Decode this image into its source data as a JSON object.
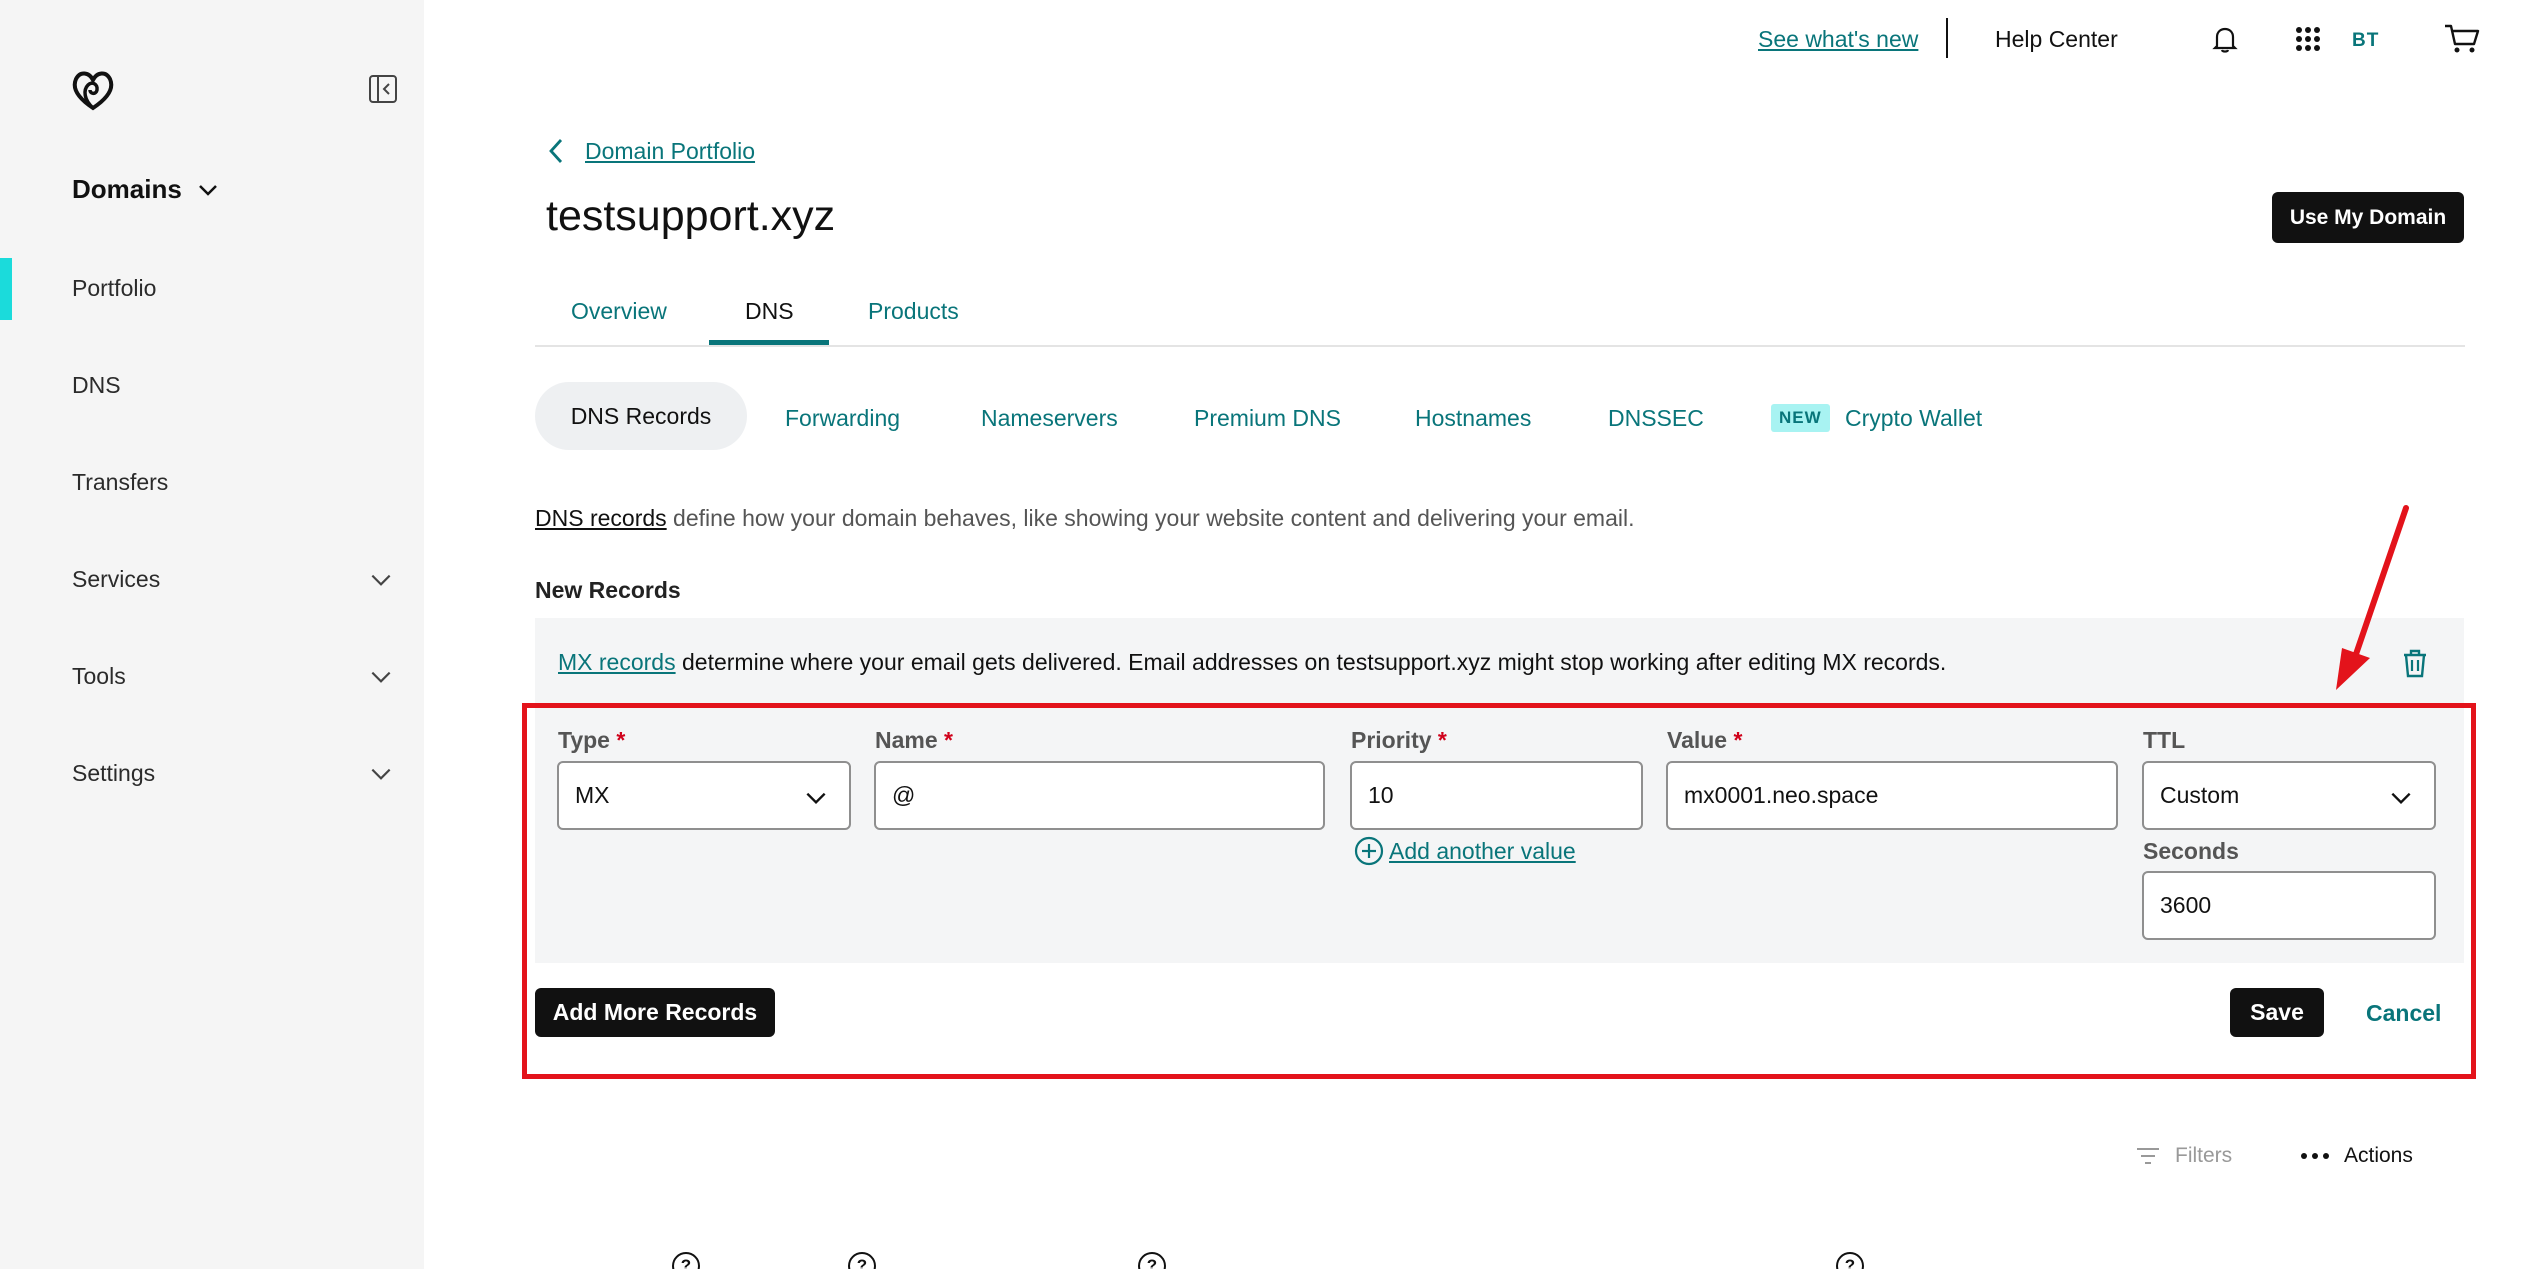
{
  "topbar": {
    "whats_new": "See what's new",
    "help_center": "Help Center",
    "avatar_initials": "BT"
  },
  "sidebar": {
    "title": "Domains",
    "items": [
      {
        "label": "Portfolio",
        "active": true
      },
      {
        "label": "DNS"
      },
      {
        "label": "Transfers"
      },
      {
        "label": "Services",
        "expandable": true
      },
      {
        "label": "Tools",
        "expandable": true
      },
      {
        "label": "Settings",
        "expandable": true
      }
    ]
  },
  "header": {
    "back_label": "Domain Portfolio",
    "domain": "testsupport.xyz",
    "use_domain_button": "Use My Domain"
  },
  "tabs": [
    "Overview",
    "DNS",
    "Products"
  ],
  "active_tab": "DNS",
  "subtabs": {
    "dns_records": "DNS Records",
    "forwarding": "Forwarding",
    "nameservers": "Nameservers",
    "premium_dns": "Premium DNS",
    "hostnames": "Hostnames",
    "dnssec": "DNSSEC",
    "new_badge": "NEW",
    "crypto_wallet": "Crypto Wallet"
  },
  "description": {
    "link": "DNS records",
    "text": " define how your domain behaves, like showing your website content and delivering your email."
  },
  "new_records_label": "New Records",
  "mx_note": {
    "link": "MX records",
    "text": " determine where your email gets delivered. Email addresses on testsupport.xyz might stop working after editing MX records."
  },
  "record_form": {
    "type_label": "Type",
    "type_value": "MX",
    "name_label": "Name",
    "name_value": "@",
    "priority_label": "Priority",
    "priority_value": "10",
    "value_label": "Value",
    "value_value": "mx0001.neo.space",
    "ttl_label": "TTL",
    "ttl_value": "Custom",
    "seconds_label": "Seconds",
    "seconds_value": "3600",
    "required_mark": "*",
    "add_another_value": "Add another value"
  },
  "buttons": {
    "add_more": "Add More Records",
    "save": "Save",
    "cancel": "Cancel"
  },
  "toolbar": {
    "filters": "Filters",
    "actions": "Actions"
  },
  "colors": {
    "accent": "#09757a",
    "highlight": "#e3131b",
    "active_bar": "#1bdbdb"
  }
}
